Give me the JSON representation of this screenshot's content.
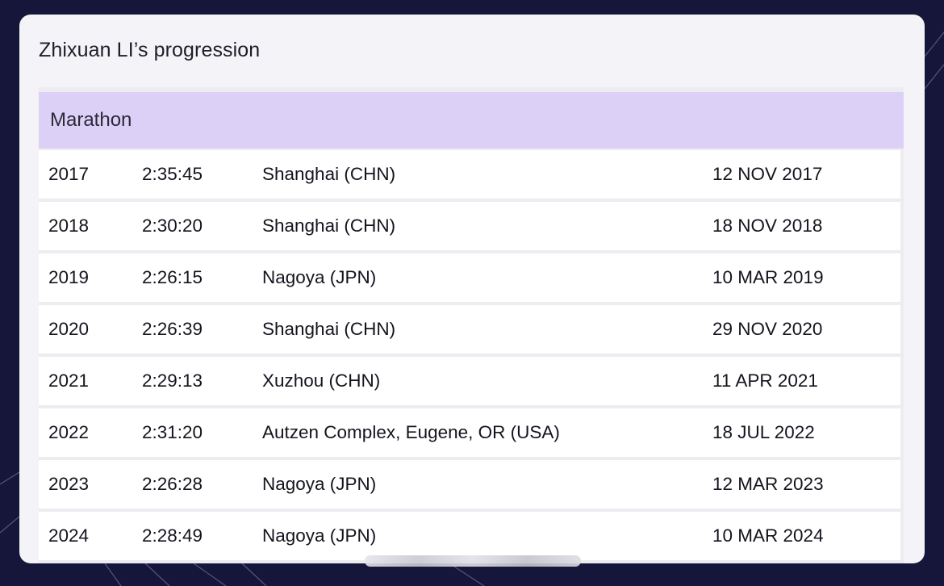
{
  "card": {
    "title": "Zhixuan LI’s progression"
  },
  "event": {
    "name": "Marathon"
  },
  "rows": [
    {
      "year": "2017",
      "mark": "2:35:45",
      "venue": "Shanghai (CHN)",
      "date": "12 NOV 2017"
    },
    {
      "year": "2018",
      "mark": "2:30:20",
      "venue": "Shanghai (CHN)",
      "date": "18 NOV 2018"
    },
    {
      "year": "2019",
      "mark": "2:26:15",
      "venue": "Nagoya (JPN)",
      "date": "10 MAR 2019"
    },
    {
      "year": "2020",
      "mark": "2:26:39",
      "venue": "Shanghai (CHN)",
      "date": "29 NOV 2020"
    },
    {
      "year": "2021",
      "mark": "2:29:13",
      "venue": "Xuzhou (CHN)",
      "date": "11 APR 2021"
    },
    {
      "year": "2022",
      "mark": "2:31:20",
      "venue": "Autzen Complex, Eugene, OR (USA)",
      "date": "18 JUL 2022"
    },
    {
      "year": "2023",
      "mark": "2:26:28",
      "venue": "Nagoya (JPN)",
      "date": "12 MAR 2023"
    },
    {
      "year": "2024",
      "mark": "2:28:49",
      "venue": "Nagoya (JPN)",
      "date": "10 MAR 2024"
    }
  ],
  "colors": {
    "page_background": "#16163a",
    "card_background": "#f4f4f8",
    "event_header": "#ddd0f7",
    "row_background": "#ffffff",
    "text": "#14141e"
  }
}
